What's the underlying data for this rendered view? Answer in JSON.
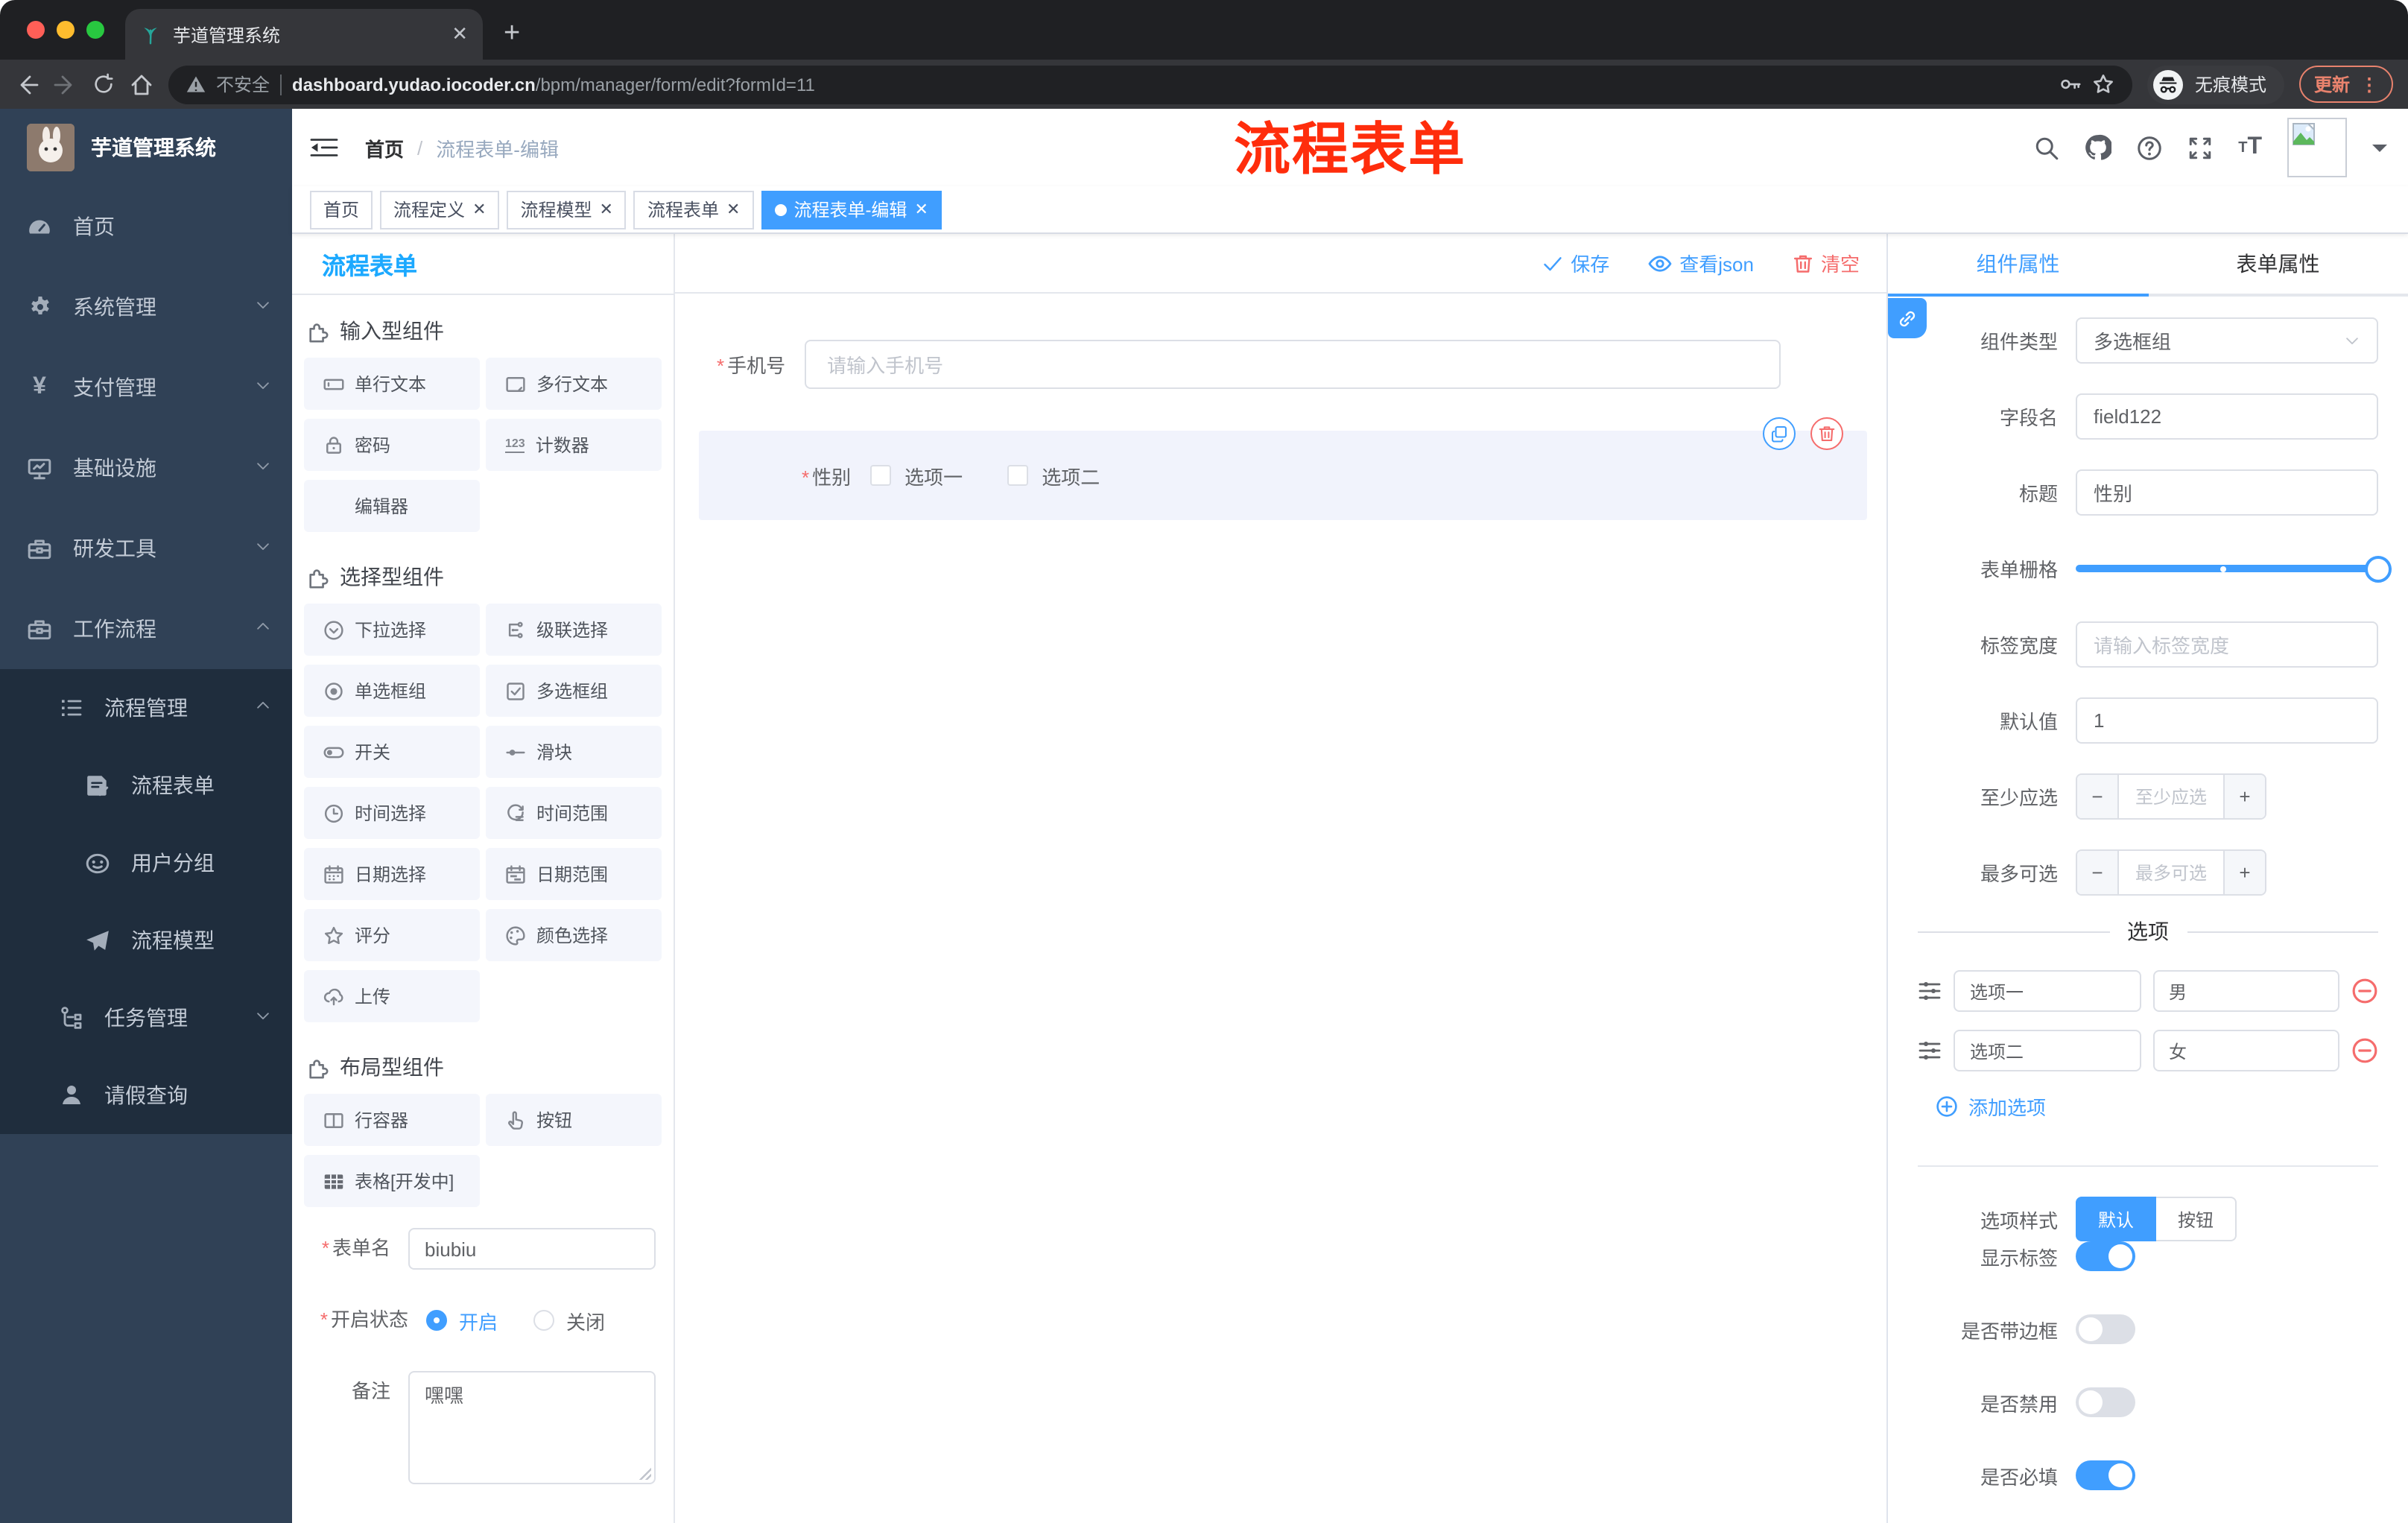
{
  "colors": {
    "accent": "#409eff",
    "danger": "#f56c6c",
    "panel_title_blue": "#1ca9ff",
    "sidebar_bg": "#304156",
    "submenu_bg": "#1f2d3d",
    "annotation_red": "#ff2d0c"
  },
  "browser": {
    "tab_title": "芋道管理系统",
    "security_label": "不安全",
    "url_domain": "dashboard.yudao.iocoder.cn",
    "url_path": "/bpm/manager/form/edit?formId=11",
    "incognito_label": "无痕模式",
    "update_label": "更新",
    "menu_dots": "⋮"
  },
  "sidebar": {
    "brand": "芋道管理系统",
    "items": [
      {
        "label": "首页",
        "icon": "dashboard-icon",
        "expandable": false
      },
      {
        "label": "系统管理",
        "icon": "gear-icon",
        "expandable": true,
        "expanded": false
      },
      {
        "label": "支付管理",
        "icon": "yen-icon",
        "expandable": true,
        "expanded": false
      },
      {
        "label": "基础设施",
        "icon": "monitor-icon",
        "expandable": true,
        "expanded": false
      },
      {
        "label": "研发工具",
        "icon": "toolbox-icon",
        "expandable": true,
        "expanded": false
      },
      {
        "label": "工作流程",
        "icon": "toolbox-icon",
        "expandable": true,
        "expanded": true
      }
    ],
    "submenu": {
      "process_mgmt": {
        "label": "流程管理",
        "icon": "list-icon",
        "expanded": true,
        "children": [
          {
            "label": "流程表单",
            "icon": "document-edit-icon"
          },
          {
            "label": "用户分组",
            "icon": "face-icon"
          },
          {
            "label": "流程模型",
            "icon": "paper-plane-icon"
          }
        ]
      },
      "task_mgmt": {
        "label": "任务管理",
        "icon": "tree-icon",
        "expanded": false
      },
      "leave_query": {
        "label": "请假查询",
        "icon": "person-icon"
      }
    }
  },
  "header": {
    "breadcrumb_home": "首页",
    "breadcrumb_separator": "/",
    "breadcrumb_current": "流程表单-编辑",
    "annotation": "流程表单"
  },
  "tabs_view": [
    {
      "label": "首页",
      "closable": false,
      "active": false
    },
    {
      "label": "流程定义",
      "closable": true,
      "active": false
    },
    {
      "label": "流程模型",
      "closable": true,
      "active": false
    },
    {
      "label": "流程表单",
      "closable": true,
      "active": false
    },
    {
      "label": "流程表单-编辑",
      "closable": true,
      "active": true
    }
  ],
  "designer": {
    "panel_title": "流程表单",
    "toolbar": {
      "save": "保存",
      "view_json": "查看json",
      "clear": "清空"
    },
    "sections": [
      {
        "title": "输入型组件",
        "items": [
          {
            "label": "单行文本",
            "icon": "input-icon"
          },
          {
            "label": "多行文本",
            "icon": "textarea-icon"
          },
          {
            "label": "密码",
            "icon": "lock-icon"
          },
          {
            "label": "计数器",
            "icon": "number-123-icon"
          },
          {
            "label": "编辑器",
            "icon": "none"
          }
        ]
      },
      {
        "title": "选择型组件",
        "items": [
          {
            "label": "下拉选择",
            "icon": "select-icon"
          },
          {
            "label": "级联选择",
            "icon": "cascade-icon"
          },
          {
            "label": "单选框组",
            "icon": "radio-icon"
          },
          {
            "label": "多选框组",
            "icon": "checkbox-icon"
          },
          {
            "label": "开关",
            "icon": "switch-icon"
          },
          {
            "label": "滑块",
            "icon": "slider-icon"
          },
          {
            "label": "时间选择",
            "icon": "clock-icon"
          },
          {
            "label": "时间范围",
            "icon": "clock-range-icon"
          },
          {
            "label": "日期选择",
            "icon": "calendar-icon"
          },
          {
            "label": "日期范围",
            "icon": "calendar-range-icon"
          },
          {
            "label": "评分",
            "icon": "star-icon"
          },
          {
            "label": "颜色选择",
            "icon": "palette-icon"
          },
          {
            "label": "上传",
            "icon": "cloud-upload-icon"
          }
        ]
      },
      {
        "title": "布局型组件",
        "items": [
          {
            "label": "行容器",
            "icon": "columns-icon"
          },
          {
            "label": "按钮",
            "icon": "pointer-icon"
          },
          {
            "label": "表格[开发中]",
            "icon": "table-icon"
          }
        ]
      }
    ],
    "meta_form": {
      "name_label": "表单名",
      "name_value": "biubiu",
      "status_label": "开启状态",
      "status_on": "开启",
      "status_off": "关闭",
      "status_value": "开启",
      "remark_label": "备注",
      "remark_value": "嘿嘿"
    },
    "canvas": {
      "phone_label": "手机号",
      "phone_placeholder": "请输入手机号",
      "gender_label": "性别",
      "gender_options": [
        "选项一",
        "选项二"
      ]
    }
  },
  "properties": {
    "tabs": [
      "组件属性",
      "表单属性"
    ],
    "active_tab": "组件属性",
    "rows": {
      "type_label": "组件类型",
      "type_value": "多选框组",
      "field_label": "字段名",
      "field_value": "field122",
      "title_label": "标题",
      "title_value": "性别",
      "grid_label": "表单栅格",
      "grid_value_percent": 100,
      "grid_mark_percent": 48,
      "width_label": "标签宽度",
      "width_placeholder": "请输入标签宽度",
      "default_label": "默认值",
      "default_value": "1",
      "min_label": "至少应选",
      "min_placeholder": "至少应选",
      "max_label": "最多可选",
      "max_placeholder": "最多可选"
    },
    "options": {
      "divider": "选项",
      "rows": [
        {
          "label": "选项一",
          "value": "男"
        },
        {
          "label": "选项二",
          "value": "女"
        }
      ],
      "add": "添加选项"
    },
    "style": {
      "label": "选项样式",
      "segments": [
        "默认",
        "按钮"
      ],
      "active": "默认"
    },
    "toggles": [
      {
        "label": "显示标签",
        "on": true
      },
      {
        "label": "是否带边框",
        "on": false
      },
      {
        "label": "是否禁用",
        "on": false
      },
      {
        "label": "是否必填",
        "on": true
      }
    ]
  }
}
